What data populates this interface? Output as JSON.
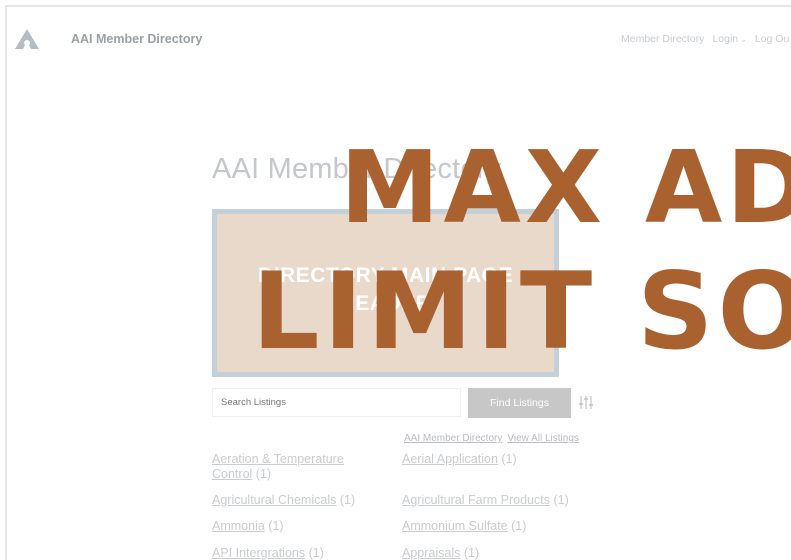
{
  "header": {
    "site_title": "AAI Member Directory",
    "nav": {
      "member_directory": "Member Directory",
      "login": "Login",
      "logout": "Log Ou"
    }
  },
  "main": {
    "page_title": "AAI Member Directory",
    "banner_line1": "DIRECTORY MAIN PAGE",
    "banner_line2": "HEADER",
    "search": {
      "placeholder": "Search Listings",
      "button_label": "Find Listings"
    },
    "crumbs": {
      "directory": "AAI Member Directory",
      "view_all": "View All Listings"
    },
    "categories": [
      {
        "label": "Aeration & Temperature Control",
        "count": "(1)"
      },
      {
        "label": "Aerial Application",
        "count": "(1)"
      },
      {
        "label": "Agricultural Chemicals",
        "count": "(1)"
      },
      {
        "label": "Agricultural Farm Products",
        "count": "(1)"
      },
      {
        "label": "Ammonia",
        "count": "(1)"
      },
      {
        "label": "Ammonium Sulfate",
        "count": "(1)"
      },
      {
        "label": "API Intergrations",
        "count": "(1)"
      },
      {
        "label": "Appraisals",
        "count": "(1)"
      }
    ]
  },
  "overlay": {
    "line1": "MAX AD",
    "line2": "LIMIT SO"
  },
  "colors": {
    "overlay": "#a8612f",
    "banner_bg": "#e8d9cb",
    "banner_border": "#c3d0d7",
    "button_bg": "#c7c7c7"
  },
  "icons": {
    "logo": "aai-logo-icon",
    "chevron": "chevron-down-icon",
    "filter": "filter-sliders-icon"
  }
}
